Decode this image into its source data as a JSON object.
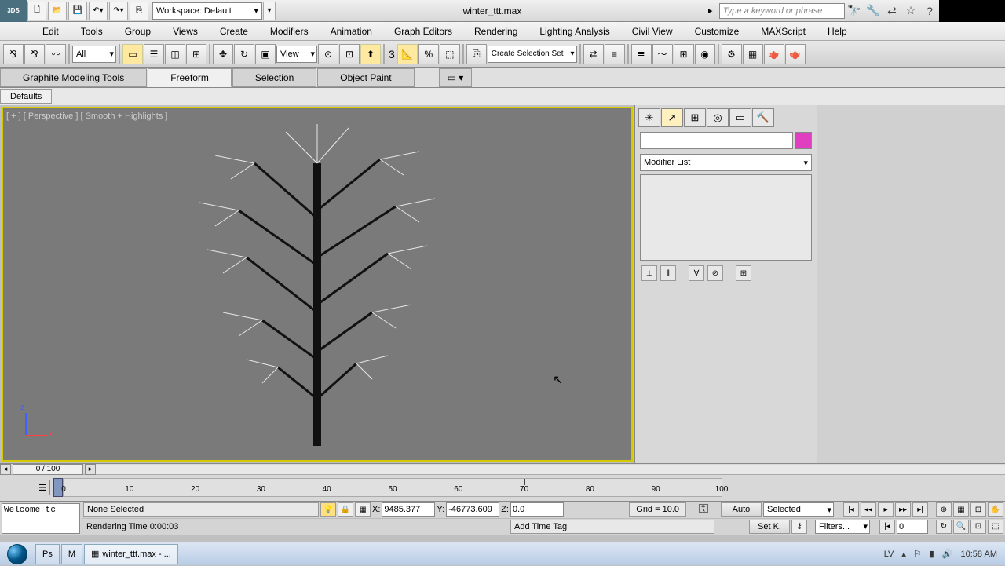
{
  "title": {
    "filename": "winter_ttt.max",
    "workspace": "Workspace: Default",
    "search_placeholder": "Type a keyword or phrase"
  },
  "menu": [
    "Edit",
    "Tools",
    "Group",
    "Views",
    "Create",
    "Modifiers",
    "Animation",
    "Graph Editors",
    "Rendering",
    "Lighting Analysis",
    "Civil View",
    "Customize",
    "MAXScript",
    "Help"
  ],
  "toolbar": {
    "filter": "All",
    "refcoord": "View",
    "axis": "3",
    "selset": "Create Selection Set"
  },
  "ribbon": {
    "tabs": [
      "Graphite Modeling Tools",
      "Freeform",
      "Selection",
      "Object Paint"
    ],
    "active": 1,
    "sub": "Defaults"
  },
  "viewport": {
    "label": "[ + ] [ Perspective ] [ Smooth + Highlights ]"
  },
  "cmd": {
    "modlist": "Modifier List"
  },
  "track": {
    "pos": "0 / 100",
    "ticks": [
      0,
      10,
      20,
      30,
      40,
      50,
      60,
      70,
      80,
      90,
      100
    ]
  },
  "status": {
    "script": "Welcome tc",
    "selection": "None Selected",
    "render": "Rendering Time  0:00:03",
    "x": "9485.377",
    "y": "-46773.609",
    "z": "0.0",
    "grid": "Grid = 10.0",
    "tag": "Add Time Tag",
    "auto": "Auto",
    "setk": "Set K.",
    "keyfilter": "Selected",
    "filters": "Filters...",
    "frame": "0"
  },
  "taskbar": {
    "app": "winter_ttt.max - ...",
    "lang": "LV",
    "time": "10:58 AM"
  }
}
